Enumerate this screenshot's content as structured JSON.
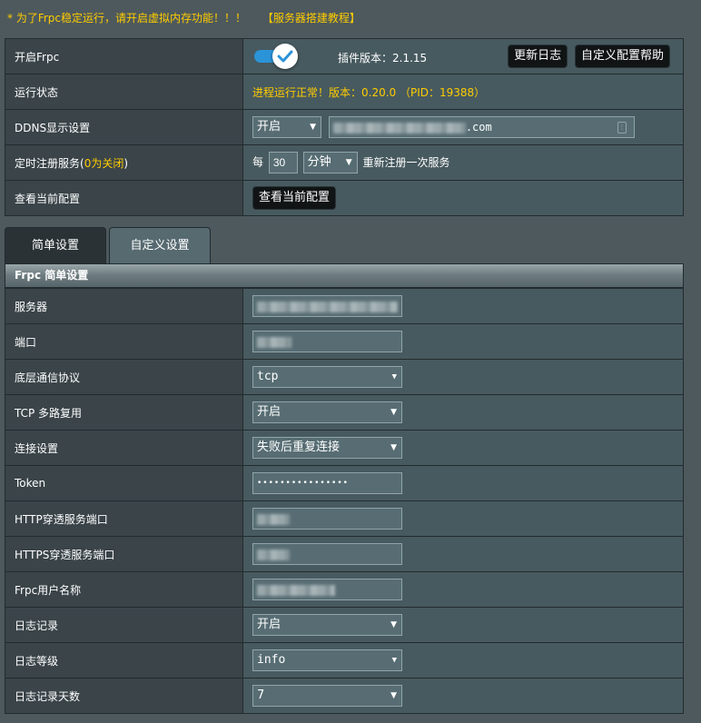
{
  "notice": {
    "text": "* 为了Frpc稳定运行，请开启虚拟内存功能！！！",
    "link": "【服务器搭建教程】"
  },
  "top": {
    "enable": {
      "label": "开启Frpc",
      "on": true,
      "plugin_version": "插件版本：2.1.15"
    },
    "buttons": {
      "changelog": "更新日志",
      "custom_help": "自定义配置帮助"
    },
    "status": {
      "label": "运行状态",
      "text": "进程运行正常！版本：0.20.0 （PID：19388）"
    },
    "ddns": {
      "label": "DDNS显示设置",
      "select": "开启",
      "domain_suffix": ".com"
    },
    "reg": {
      "label_prefix": "定时注册服务(",
      "label_zero": "0为关闭",
      "label_suffix": ")",
      "every": "每",
      "value": "30",
      "unit": "分钟",
      "tail": "重新注册一次服务"
    },
    "view_config": {
      "label": "查看当前配置",
      "button": "查看当前配置"
    }
  },
  "tabs": {
    "simple": "简单设置",
    "custom": "自定义设置"
  },
  "section": {
    "title": "Frpc 简单设置"
  },
  "simple": {
    "server": {
      "label": "服务器"
    },
    "port": {
      "label": "端口"
    },
    "protocol": {
      "label": "底层通信协议",
      "value": "tcp"
    },
    "tcp_mux": {
      "label": "TCP 多路复用",
      "value": "开启"
    },
    "conn": {
      "label": "连接设置",
      "value": "失败后重复连接"
    },
    "token": {
      "label": "Token",
      "value": "••••••••••••••••"
    },
    "http_port": {
      "label": "HTTP穿透服务端口"
    },
    "https_port": {
      "label": "HTTPS穿透服务端口"
    },
    "user": {
      "label": "Frpc用户名称"
    },
    "log": {
      "label": "日志记录",
      "value": "开启"
    },
    "log_level": {
      "label": "日志等级",
      "value": "info"
    },
    "log_days": {
      "label": "日志记录天数",
      "value": "7"
    }
  },
  "colors": {
    "accent": "#2b93d8",
    "warn": "#ffcc00",
    "panel": "#475a5f",
    "label_bg": "#3a4449"
  }
}
